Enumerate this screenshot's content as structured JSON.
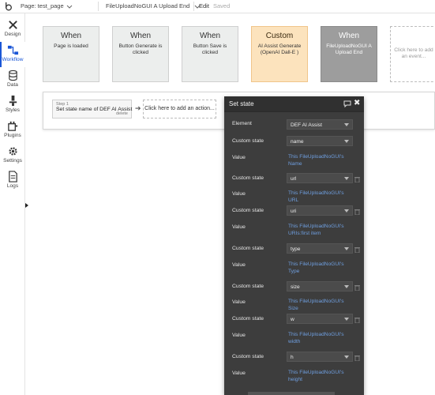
{
  "topbar": {
    "page_label": "Page: test_page",
    "workflow_label": "FileUploadNoGUI A Upload End",
    "edit_label": "Edit",
    "saved_label": "Saved"
  },
  "sidebar": {
    "items": [
      {
        "label": "Design",
        "icon": "design-icon"
      },
      {
        "label": "Workflow",
        "icon": "workflow-icon",
        "active": true
      },
      {
        "label": "Data",
        "icon": "data-icon"
      },
      {
        "label": "Styles",
        "icon": "styles-icon"
      },
      {
        "label": "Plugins",
        "icon": "plugins-icon"
      },
      {
        "label": "Settings",
        "icon": "settings-icon"
      },
      {
        "label": "Logs",
        "icon": "logs-icon"
      }
    ],
    "accent_color": "#1a56d6"
  },
  "events": [
    {
      "title": "When",
      "subtitle": "Page is loaded"
    },
    {
      "title": "When",
      "subtitle": "Button Generate is clicked"
    },
    {
      "title": "When",
      "subtitle": "Button Save is clicked"
    },
    {
      "title": "Custom",
      "subtitle": "AI Assist Generate (OpenAI Dall-E )"
    },
    {
      "title": "When",
      "subtitle": "FileUploadNoGUI A Upload End"
    },
    {
      "title": "",
      "subtitle": "Click here to add an event..."
    }
  ],
  "actions": {
    "step_num": "Step 1",
    "step_title": "Set state name of DEF AI Assist",
    "step_delete": "delete",
    "add_action": "Click here to add an action..."
  },
  "editor": {
    "title": "Set state",
    "element_label": "Element",
    "element_value": "DEF AI Assist",
    "rows": [
      {
        "state_label": "Custom state",
        "state": "name",
        "value_label": "Value",
        "value": "This FileUploadNoGUI's Name"
      },
      {
        "state_label": "Custom state",
        "state": "url",
        "value_label": "Value",
        "value": "This FileUploadNoGUI's URL"
      },
      {
        "state_label": "Custom state",
        "state": "uri",
        "value_label": "Value",
        "value": "This FileUploadNoGUI's URIs:first item"
      },
      {
        "state_label": "Custom state",
        "state": "type",
        "value_label": "Value",
        "value": "This FileUploadNoGUI's Type"
      },
      {
        "state_label": "Custom state",
        "state": "size",
        "value_label": "Value",
        "value": "This FileUploadNoGUI's Size"
      },
      {
        "state_label": "Custom state",
        "state": "w",
        "value_label": "Value",
        "value": "This FileUploadNoGUI's width"
      },
      {
        "state_label": "Custom state",
        "state": "h",
        "value_label": "Value",
        "value": "This FileUploadNoGUI's height"
      }
    ]
  }
}
